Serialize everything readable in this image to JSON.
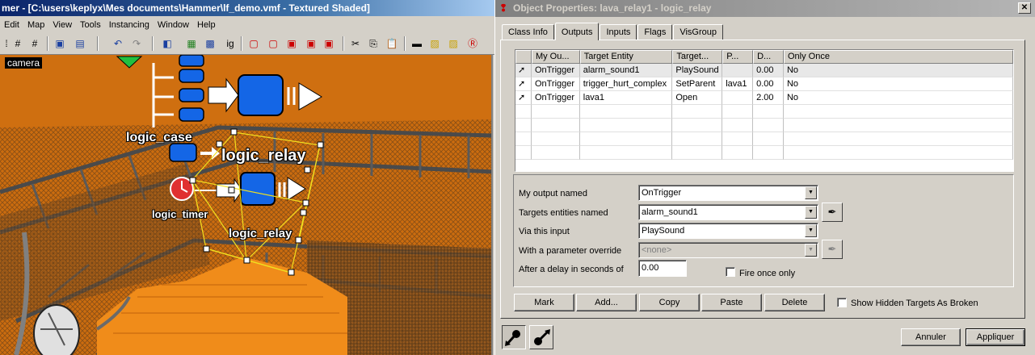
{
  "hammer": {
    "title": "mer - [C:\\users\\keplyx\\Mes documents\\Hammer\\lf_demo.vmf - Textured Shaded]",
    "menu": [
      "Edit",
      "Map",
      "View",
      "Tools",
      "Instancing",
      "Window",
      "Help"
    ],
    "viewport_label": "camera",
    "entities": {
      "logic_case": "logic_case",
      "logic_relay_top": "logic_relay",
      "logic_timer": "logic_timer",
      "logic_relay_bottom": "logic_relay"
    }
  },
  "props": {
    "title": "Object Properties: lava_relay1 - logic_relay",
    "close": "✕",
    "tabs": [
      "Class Info",
      "Outputs",
      "Inputs",
      "Flags",
      "VisGroup"
    ],
    "active_tab": "Outputs",
    "columns": [
      "",
      "My Ou...",
      "Target Entity",
      "Target...",
      "P...",
      "D...",
      "Only Once"
    ],
    "rows": [
      {
        "output": "OnTrigger",
        "target": "alarm_sound1",
        "input": "PlaySound",
        "param": "",
        "delay": "0.00",
        "once": "No"
      },
      {
        "output": "OnTrigger",
        "target": "trigger_hurt_complex",
        "input": "SetParent",
        "param": "lava1",
        "delay": "0.00",
        "once": "No"
      },
      {
        "output": "OnTrigger",
        "target": "lava1",
        "input": "Open",
        "param": "",
        "delay": "2.00",
        "once": "No"
      }
    ],
    "form": {
      "output_label": "My output named",
      "output_value": "OnTrigger",
      "targets_label": "Targets entities named",
      "targets_value": "alarm_sound1",
      "input_label": "Via this input",
      "input_value": "PlaySound",
      "param_label": "With a parameter override",
      "param_value": "<none>",
      "delay_label": "After a delay in seconds of",
      "delay_value": "0.00",
      "fire_once_label": "Fire once only"
    },
    "buttons": {
      "mark": "Mark",
      "add": "Add...",
      "copy": "Copy",
      "paste": "Paste",
      "delete": "Delete",
      "show_hidden": "Show Hidden Targets As Broken",
      "cancel": "Annuler",
      "apply": "Appliquer"
    }
  }
}
